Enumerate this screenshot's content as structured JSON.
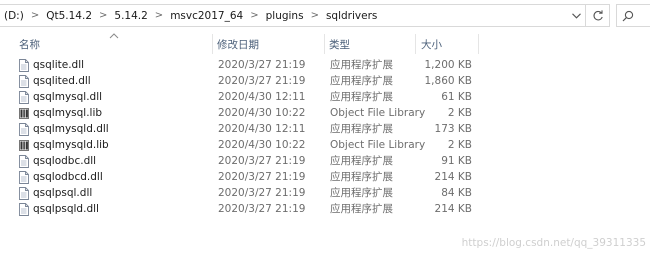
{
  "address": {
    "crumbs": [
      "(D:)",
      "Qt5.14.2",
      "5.14.2",
      "msvc2017_64",
      "plugins",
      "sqldrivers"
    ],
    "separator": ">"
  },
  "columns": {
    "name": "名称",
    "date": "修改日期",
    "type": "类型",
    "size": "大小"
  },
  "files": [
    {
      "name": "qsqlite.dll",
      "date": "2020/3/27 21:19",
      "type": "应用程序扩展",
      "size": "1,200 KB",
      "icon": "dll-file-icon"
    },
    {
      "name": "qsqlited.dll",
      "date": "2020/3/27 21:19",
      "type": "应用程序扩展",
      "size": "1,860 KB",
      "icon": "dll-file-icon"
    },
    {
      "name": "qsqlmysql.dll",
      "date": "2020/4/30 12:11",
      "type": "应用程序扩展",
      "size": "61 KB",
      "icon": "dll-file-icon"
    },
    {
      "name": "qsqlmysql.lib",
      "date": "2020/4/30 10:22",
      "type": "Object File Library",
      "size": "2 KB",
      "icon": "lib-file-icon"
    },
    {
      "name": "qsqlmysqld.dll",
      "date": "2020/4/30 12:11",
      "type": "应用程序扩展",
      "size": "173 KB",
      "icon": "dll-file-icon"
    },
    {
      "name": "qsqlmysqld.lib",
      "date": "2020/4/30 10:22",
      "type": "Object File Library",
      "size": "2 KB",
      "icon": "lib-file-icon"
    },
    {
      "name": "qsqlodbc.dll",
      "date": "2020/3/27 21:19",
      "type": "应用程序扩展",
      "size": "91 KB",
      "icon": "dll-file-icon"
    },
    {
      "name": "qsqlodbcd.dll",
      "date": "2020/3/27 21:19",
      "type": "应用程序扩展",
      "size": "214 KB",
      "icon": "dll-file-icon"
    },
    {
      "name": "qsqlpsql.dll",
      "date": "2020/3/27 21:19",
      "type": "应用程序扩展",
      "size": "84 KB",
      "icon": "dll-file-icon"
    },
    {
      "name": "qsqlpsqld.dll",
      "date": "2020/3/27 21:19",
      "type": "应用程序扩展",
      "size": "214 KB",
      "icon": "dll-file-icon"
    }
  ],
  "watermark": "https://blog.csdn.net/qq_39311335"
}
